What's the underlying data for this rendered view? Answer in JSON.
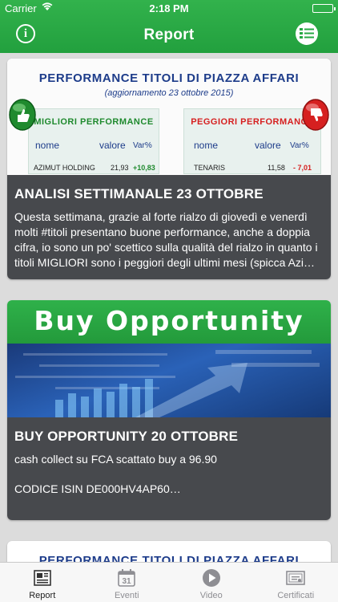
{
  "status_bar": {
    "carrier": "Carrier",
    "time": "2:18 PM"
  },
  "nav": {
    "title": "Report"
  },
  "cards": [
    {
      "image": {
        "title": "PERFORMANCE TITOLI DI PIAZZA AFFARI",
        "subtitle": "(aggiornamento 23 ottobre 2015)",
        "best_header": "MIGLIORI PERFORMANCE",
        "worst_header": "PEGGIORI PERFORMANCE",
        "col_name": "nome",
        "col_value": "valore",
        "col_var": "Var%",
        "best_row": {
          "name": "AZIMUT HOLDING",
          "value": "21,93",
          "var": "+10,83"
        },
        "worst_row": {
          "name": "TENARIS",
          "value": "11,58",
          "var": "- 7,01"
        }
      },
      "title": "ANALISI SETTIMANALE 23 OTTOBRE",
      "description": "Questa settimana, grazie al forte rialzo di giovedì e venerdì molti #titoli presentano buone performance, anche a doppia cifra, io sono un po' scettico sulla qualità del rialzo in quanto i titoli MIGLIORI sono i peggiori degli ultimi mesi (spicca Azimut Holding)"
    },
    {
      "image": {
        "banner": "Buy Opportunity"
      },
      "title": "BUY OPPORTUNITY 20 OTTOBRE",
      "line1": "cash collect su FCA  scattato buy a 96.90",
      "line2": "CODICE ISIN DE000HV4AP60…"
    },
    {
      "image": {
        "title": "PERFORMANCE TITOLI DI PIAZZA AFFARI"
      }
    }
  ],
  "tabs": [
    {
      "label": "Report",
      "icon": "newspaper-icon",
      "active": true
    },
    {
      "label": "Eventi",
      "icon": "calendar-icon",
      "day": "31"
    },
    {
      "label": "Video",
      "icon": "play-icon"
    },
    {
      "label": "Certificati",
      "icon": "certificate-icon"
    }
  ],
  "colors": {
    "accent": "#27a843",
    "overlay": "#2d3034",
    "title_blue": "#1d3c8a",
    "best_green": "#1f8a2e",
    "worst_red": "#d62020"
  }
}
